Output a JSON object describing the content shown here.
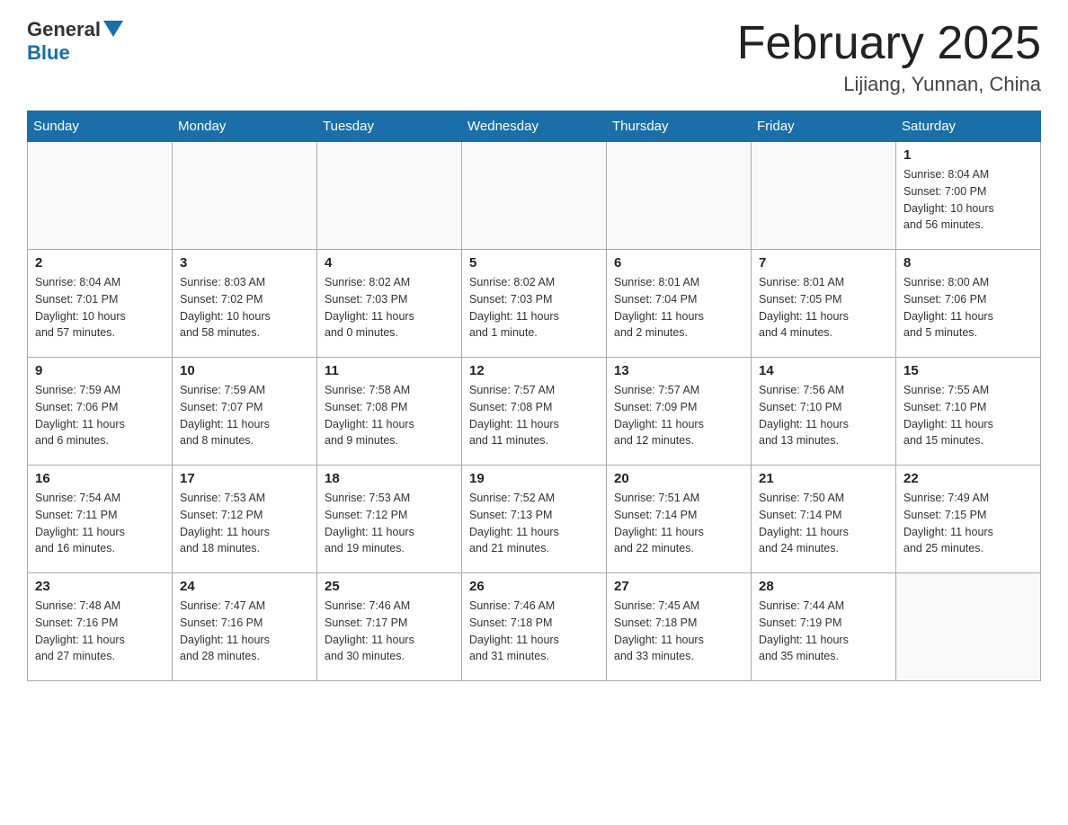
{
  "header": {
    "logo_general": "General",
    "logo_blue": "Blue",
    "month_title": "February 2025",
    "location": "Lijiang, Yunnan, China"
  },
  "weekdays": [
    "Sunday",
    "Monday",
    "Tuesday",
    "Wednesday",
    "Thursday",
    "Friday",
    "Saturday"
  ],
  "weeks": [
    [
      {
        "day": "",
        "info": ""
      },
      {
        "day": "",
        "info": ""
      },
      {
        "day": "",
        "info": ""
      },
      {
        "day": "",
        "info": ""
      },
      {
        "day": "",
        "info": ""
      },
      {
        "day": "",
        "info": ""
      },
      {
        "day": "1",
        "info": "Sunrise: 8:04 AM\nSunset: 7:00 PM\nDaylight: 10 hours\nand 56 minutes."
      }
    ],
    [
      {
        "day": "2",
        "info": "Sunrise: 8:04 AM\nSunset: 7:01 PM\nDaylight: 10 hours\nand 57 minutes."
      },
      {
        "day": "3",
        "info": "Sunrise: 8:03 AM\nSunset: 7:02 PM\nDaylight: 10 hours\nand 58 minutes."
      },
      {
        "day": "4",
        "info": "Sunrise: 8:02 AM\nSunset: 7:03 PM\nDaylight: 11 hours\nand 0 minutes."
      },
      {
        "day": "5",
        "info": "Sunrise: 8:02 AM\nSunset: 7:03 PM\nDaylight: 11 hours\nand 1 minute."
      },
      {
        "day": "6",
        "info": "Sunrise: 8:01 AM\nSunset: 7:04 PM\nDaylight: 11 hours\nand 2 minutes."
      },
      {
        "day": "7",
        "info": "Sunrise: 8:01 AM\nSunset: 7:05 PM\nDaylight: 11 hours\nand 4 minutes."
      },
      {
        "day": "8",
        "info": "Sunrise: 8:00 AM\nSunset: 7:06 PM\nDaylight: 11 hours\nand 5 minutes."
      }
    ],
    [
      {
        "day": "9",
        "info": "Sunrise: 7:59 AM\nSunset: 7:06 PM\nDaylight: 11 hours\nand 6 minutes."
      },
      {
        "day": "10",
        "info": "Sunrise: 7:59 AM\nSunset: 7:07 PM\nDaylight: 11 hours\nand 8 minutes."
      },
      {
        "day": "11",
        "info": "Sunrise: 7:58 AM\nSunset: 7:08 PM\nDaylight: 11 hours\nand 9 minutes."
      },
      {
        "day": "12",
        "info": "Sunrise: 7:57 AM\nSunset: 7:08 PM\nDaylight: 11 hours\nand 11 minutes."
      },
      {
        "day": "13",
        "info": "Sunrise: 7:57 AM\nSunset: 7:09 PM\nDaylight: 11 hours\nand 12 minutes."
      },
      {
        "day": "14",
        "info": "Sunrise: 7:56 AM\nSunset: 7:10 PM\nDaylight: 11 hours\nand 13 minutes."
      },
      {
        "day": "15",
        "info": "Sunrise: 7:55 AM\nSunset: 7:10 PM\nDaylight: 11 hours\nand 15 minutes."
      }
    ],
    [
      {
        "day": "16",
        "info": "Sunrise: 7:54 AM\nSunset: 7:11 PM\nDaylight: 11 hours\nand 16 minutes."
      },
      {
        "day": "17",
        "info": "Sunrise: 7:53 AM\nSunset: 7:12 PM\nDaylight: 11 hours\nand 18 minutes."
      },
      {
        "day": "18",
        "info": "Sunrise: 7:53 AM\nSunset: 7:12 PM\nDaylight: 11 hours\nand 19 minutes."
      },
      {
        "day": "19",
        "info": "Sunrise: 7:52 AM\nSunset: 7:13 PM\nDaylight: 11 hours\nand 21 minutes."
      },
      {
        "day": "20",
        "info": "Sunrise: 7:51 AM\nSunset: 7:14 PM\nDaylight: 11 hours\nand 22 minutes."
      },
      {
        "day": "21",
        "info": "Sunrise: 7:50 AM\nSunset: 7:14 PM\nDaylight: 11 hours\nand 24 minutes."
      },
      {
        "day": "22",
        "info": "Sunrise: 7:49 AM\nSunset: 7:15 PM\nDaylight: 11 hours\nand 25 minutes."
      }
    ],
    [
      {
        "day": "23",
        "info": "Sunrise: 7:48 AM\nSunset: 7:16 PM\nDaylight: 11 hours\nand 27 minutes."
      },
      {
        "day": "24",
        "info": "Sunrise: 7:47 AM\nSunset: 7:16 PM\nDaylight: 11 hours\nand 28 minutes."
      },
      {
        "day": "25",
        "info": "Sunrise: 7:46 AM\nSunset: 7:17 PM\nDaylight: 11 hours\nand 30 minutes."
      },
      {
        "day": "26",
        "info": "Sunrise: 7:46 AM\nSunset: 7:18 PM\nDaylight: 11 hours\nand 31 minutes."
      },
      {
        "day": "27",
        "info": "Sunrise: 7:45 AM\nSunset: 7:18 PM\nDaylight: 11 hours\nand 33 minutes."
      },
      {
        "day": "28",
        "info": "Sunrise: 7:44 AM\nSunset: 7:19 PM\nDaylight: 11 hours\nand 35 minutes."
      },
      {
        "day": "",
        "info": ""
      }
    ]
  ]
}
